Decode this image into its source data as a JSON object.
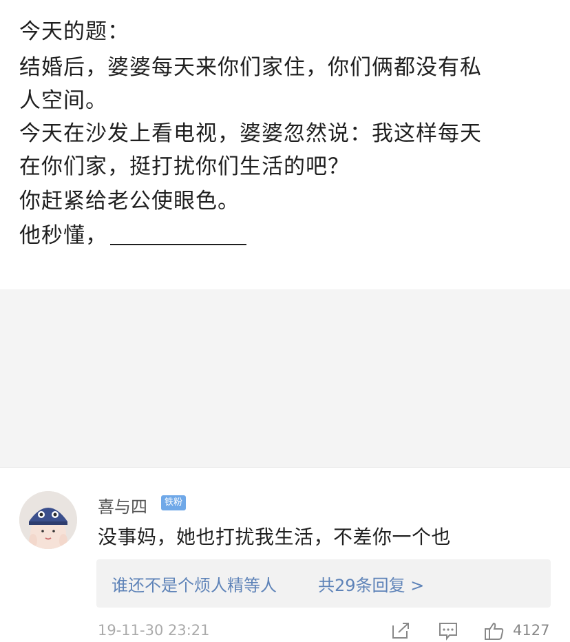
{
  "post": {
    "lines": [
      "今天的题：",
      "结婚后，婆婆每天来你们家住，你们俩都没有私",
      "人空间。",
      "今天在沙发上看电视，婆婆忽然说：我这样每天",
      "在你们家，挺打扰你们生活的吧？",
      "你赶紧给老公使眼色。",
      "他秒懂，"
    ]
  },
  "comment": {
    "username": "喜与四",
    "badge": "铁粉",
    "text": "没事妈，她也打扰我生活，不差你一个也",
    "replies": {
      "user": "谁还不是个烦人精等人",
      "count_label": "共29条回复 >"
    },
    "timestamp": "19-11-30 23:21",
    "icons": {
      "share": "share-icon",
      "comment": "comment-icon",
      "like": "thumbs-up-icon"
    },
    "likes": "4127"
  },
  "colors": {
    "link_blue": "#5e83b8",
    "badge_blue": "#6fa8e8",
    "gray_bg": "#f4f4f4"
  }
}
